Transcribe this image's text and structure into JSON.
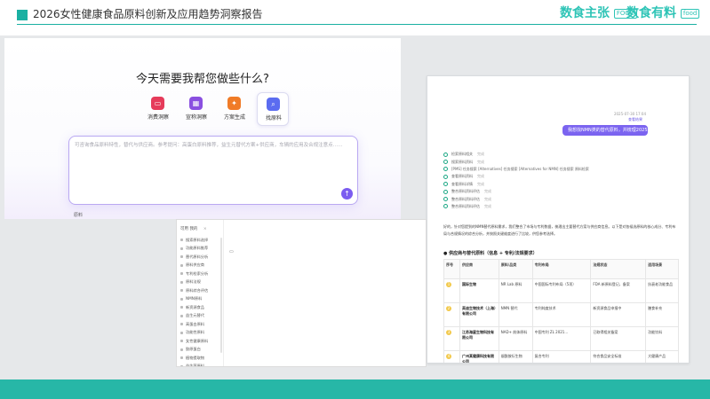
{
  "slide": {
    "title": "2026女性健康食品原料创新及应用趋势洞察报告",
    "brand_left": "数食主张",
    "brand_left_badge": "FOOD",
    "brand_right": "数食有料",
    "brand_right_badge": "food",
    "colors": {
      "accent": "#1ab0a2",
      "footer": "#27b7a7",
      "primary": "#7b5cf0"
    }
  },
  "main": {
    "prompt_title": "今天需要我帮您做些什么?",
    "actions": [
      {
        "label": "消费洞察",
        "icon": "book-icon",
        "color": "#e63b5a"
      },
      {
        "label": "宣称洞察",
        "icon": "grid-icon",
        "color": "#8a4fe0"
      },
      {
        "label": "方案生成",
        "icon": "spark-icon",
        "color": "#f07b27"
      },
      {
        "label": "找原料",
        "icon": "search-icon",
        "color": "#5b6cf0",
        "selected": true
      }
    ],
    "input_placeholder": "可咨询食品原料特性，替代与供应商。参考提问：高蛋白原料推荐，益生元替代方案+供应商，车辆的应用及合规注意点……",
    "send_icon": "arrow-up-icon",
    "below_label": "原料"
  },
  "right": {
    "time": "2025-07-30 17:04",
    "link": "查看结果",
    "bubble": "我想找NMN类的替代原料，并梳理2025年供应商。",
    "steps": [
      {
        "label": "检索原料相关",
        "status": "完成"
      },
      {
        "label": "搜索原料资料",
        "status": "完成"
      },
      {
        "label": "[PMS] 任务搜索  [Alternatives]  任务搜索 [Alternatives for NMN] 任务搜索  原料检索",
        "status": ""
      },
      {
        "label": "查看原料资料",
        "status": "完成"
      },
      {
        "label": "查看原料详情",
        "status": "完成"
      },
      {
        "label": "整合原料资料评估",
        "status": "完成"
      },
      {
        "label": "整合原料资料评估",
        "status": "完成"
      },
      {
        "label": "整合原料资料评估",
        "status": "完成"
      }
    ],
    "paragraph": "好的，针对您提到的NMN替代原料需求，我们整合了市场与专利数据，梳理出主要替代方案与供应商信息。以下是对各候选原料的核心成分、专利布局与合规情况的综合分析，并按照关键维度进行了比较，供您参考选择。",
    "section_title": "● 供应商与替代原料（信息 + 专利/法规要求）",
    "table": {
      "headers": [
        "序号",
        "供应商",
        "原料/品类",
        "专利布局",
        "法规状态",
        "适用场景"
      ],
      "rows": [
        [
          "1",
          "国际生物",
          "NR Lab 原料",
          "中国国际专利布局（5项）",
          "FDA 新原料登记，备案",
          "抗衰老功能食品"
        ],
        [
          "2",
          "英迪生物技术（上海）有限公司",
          "NMN 替代",
          "专利纯度技术",
          "新资源食品申报中",
          "膳食补充"
        ],
        [
          "3",
          "江苏海星生物科技有限公司",
          "NAD+ 前体原料",
          "中国专利 ZL 2021...",
          "已取得相关备案",
          "功能饮料"
        ],
        [
          "4",
          "广州某健康科技有限公司",
          "烟酰胺衍生物",
          "复合专利",
          "符合食品安全标准",
          "大健康产品"
        ]
      ]
    }
  },
  "side": {
    "top_label": "可用",
    "top_label2": "我的",
    "items": [
      "搜索原料选择",
      "功能原料推荐",
      "替代原料分析",
      "原料供应商",
      "专利检索分析",
      "原料法规",
      "原料综合评估",
      "NMN原料",
      "新资源食品",
      "益生元替代",
      "高蛋白原料",
      "功能性原料",
      "女性健康原料",
      "胶原蛋白",
      "植物提取物",
      "益生菌原料",
      "膳食纤维"
    ],
    "icon": "sidebar-toggle-icon"
  }
}
